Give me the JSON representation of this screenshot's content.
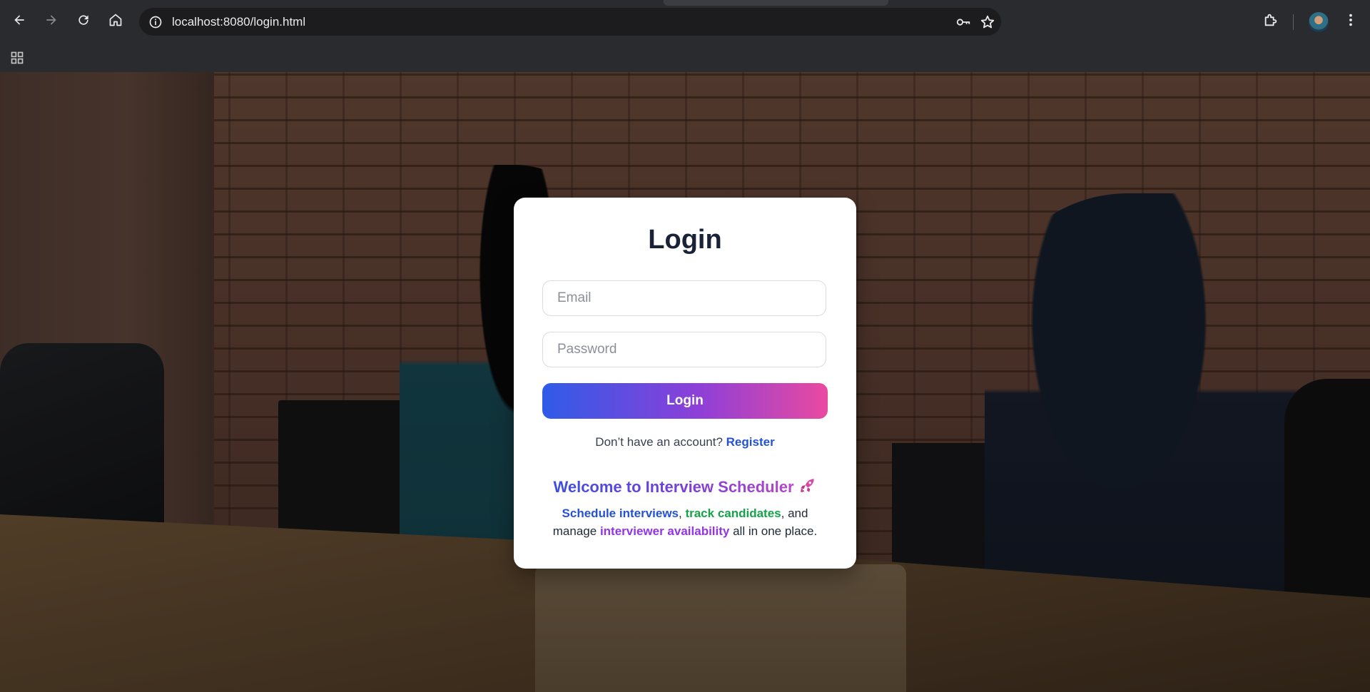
{
  "browser": {
    "url": "localhost:8080/login.html",
    "icons": {
      "back": "back-arrow-icon",
      "forward": "forward-arrow-icon",
      "reload": "reload-icon",
      "home": "home-icon",
      "site_info": "info-icon",
      "password_key": "key-icon",
      "bookmark": "star-icon",
      "extensions": "puzzle-icon",
      "menu": "kebab-menu-icon",
      "apps": "apps-grid-icon"
    }
  },
  "login": {
    "title": "Login",
    "email_placeholder": "Email",
    "password_placeholder": "Password",
    "button_label": "Login",
    "register_prompt": "Don’t have an account?",
    "register_link": "Register",
    "welcome_text": "Welcome to Interview Scheduler",
    "welcome_icon": "rocket-icon",
    "desc": {
      "schedule": "Schedule interviews",
      "sep1": ", ",
      "track": "track candidates",
      "sep2": ", and manage ",
      "availability": "interviewer availability",
      "tail": " all in one place."
    }
  },
  "colors": {
    "gradient_start": "#2f5be8",
    "gradient_mid": "#8e3fd8",
    "gradient_end": "#e94aa0",
    "link_blue": "#2352d8",
    "green": "#16a34a",
    "purple": "#9333ea",
    "title": "#1a2238"
  }
}
